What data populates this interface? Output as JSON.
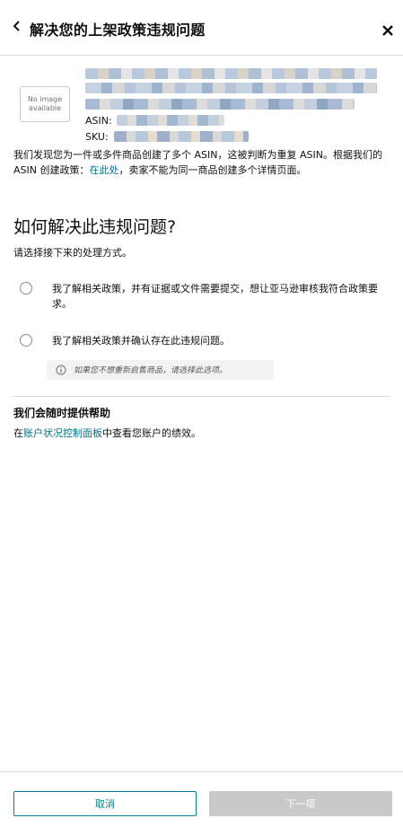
{
  "header": {
    "title": "解决您的上架政策违规问题"
  },
  "product": {
    "no_image_line1": "No image",
    "no_image_line2": "available",
    "asin_label": "ASIN: ",
    "sku_label": "SKU: "
  },
  "description": {
    "text_before_link": "我们发现您为一件或多件商品创建了多个 ASIN，这被判断为重复 ASIN。根据我们的 ASIN 创建政策：",
    "link": "在此处",
    "text_after_link": "，卖家不能为同一商品创建多个详情页面。"
  },
  "resolve": {
    "title": "如何解决此违规问题?",
    "subtitle": "请选择接下来的处理方式。",
    "options": [
      {
        "label": "我了解相关政策，并有证据或文件需要提交，想让亚马逊审核我符合政策要求。"
      },
      {
        "label": "我了解相关政策并确认存在此违规问题。"
      }
    ],
    "hint": "如果您不想重新启售商品，请选择此选项。"
  },
  "help": {
    "title": "我们会随时提供帮助",
    "text_before_link": "在",
    "link": "账户状况控制面板",
    "text_after_link": "中查看您账户的绩效。"
  },
  "footer": {
    "cancel_label": "取消",
    "next_label": "下一项"
  },
  "colors": {
    "link": "#007185",
    "button_outline": "#008296",
    "disabled_button": "#c9c9c9"
  }
}
